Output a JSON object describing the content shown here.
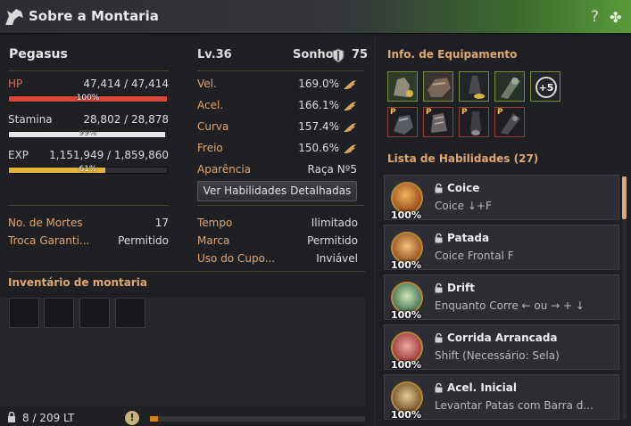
{
  "window": {
    "title": "Sobre a Montaria",
    "help_icon": "?",
    "accent": "#e0a770"
  },
  "mount": {
    "name": "Pegasus",
    "level": "Lv.36",
    "dream_label": "Sonho",
    "dream_value": "75"
  },
  "stats": {
    "hp": {
      "label": "HP",
      "value": "47,414 / 47,414",
      "pct": "100%",
      "fraction": 1.0,
      "color": "#d9473b"
    },
    "stamina": {
      "label": "Stamina",
      "value": "28,802 / 28,878",
      "pct": "99%",
      "fraction": 0.99,
      "color": "#e6e6e6"
    },
    "exp": {
      "label": "EXP",
      "value": "1,151,949 / 1,859,860",
      "pct": "61%",
      "fraction": 0.61,
      "color": "#e3b43a"
    }
  },
  "speeds": [
    {
      "label": "Vel.",
      "value": "169.0%"
    },
    {
      "label": "Acel.",
      "value": "166.1%"
    },
    {
      "label": "Curva",
      "value": "157.4%"
    },
    {
      "label": "Freio",
      "value": "150.6%"
    }
  ],
  "appearance": {
    "label": "Aparência",
    "value": "Raça Nº5"
  },
  "details_button": "Ver Habilidades Detalhadas",
  "info": {
    "deaths_label": "No. de Mortes",
    "deaths_value": "17",
    "trade_label": "Troca Garanti...",
    "trade_value": "Permitido",
    "time_label": "Tempo",
    "time_value": "Ilimitado",
    "mark_label": "Marca",
    "mark_value": "Permitido",
    "coupon_label": "Uso do Cupo...",
    "coupon_value": "Inviável"
  },
  "inventory": {
    "title": "Inventário de montaria",
    "weight": "8 / 209 LT",
    "warning": "!",
    "weight_fraction": 0.038
  },
  "equipment": {
    "title": "Info. de Equipamento",
    "enhance_label": "+5",
    "slot_marker": "P"
  },
  "skills": {
    "title": "Lista de Habilidades (27)",
    "items": [
      {
        "name": "Coice",
        "desc": "Coice ↓+F",
        "pct": "100%"
      },
      {
        "name": "Patada",
        "desc": "Coice Frontal F",
        "pct": "100%"
      },
      {
        "name": "Drift",
        "desc": "Enquanto Corre ← ou → + ↓",
        "pct": "100%"
      },
      {
        "name": "Corrida Arrancada",
        "desc": "Shift (Necessário: Sela)",
        "pct": "100%"
      },
      {
        "name": "Acel. Inicial",
        "desc": "Levantar Patas com Barra d...",
        "pct": "100%"
      }
    ]
  }
}
